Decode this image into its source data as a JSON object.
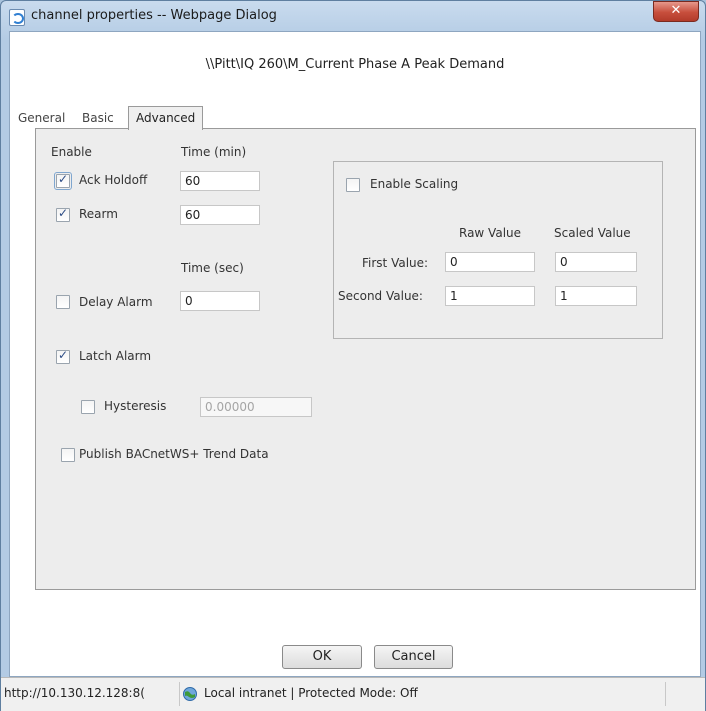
{
  "window": {
    "title": "channel properties -- Webpage Dialog",
    "close_label": "✕"
  },
  "header": {
    "path": "\\\\Pitt\\IQ 260\\M_Current Phase A Peak Demand"
  },
  "tabs": [
    {
      "label": "General",
      "active": false
    },
    {
      "label": "Basic",
      "active": false
    },
    {
      "label": "Advanced",
      "active": true
    }
  ],
  "advanced": {
    "enable_header": "Enable",
    "time_min_header": "Time (min)",
    "time_sec_header": "Time (sec)",
    "ack_holdoff": {
      "label": "Ack Holdoff",
      "checked": true,
      "value": "60"
    },
    "rearm": {
      "label": "Rearm",
      "checked": true,
      "value": "60"
    },
    "delay_alarm": {
      "label": "Delay Alarm",
      "checked": false,
      "value": "0"
    },
    "latch_alarm": {
      "label": "Latch Alarm",
      "checked": true
    },
    "hysteresis": {
      "label": "Hysteresis",
      "checked": false,
      "value": "0.00000"
    },
    "publish": {
      "label": "Publish BACnetWS+ Trend Data",
      "checked": false
    }
  },
  "scaling": {
    "enable_label": "Enable Scaling",
    "enabled": false,
    "raw_header": "Raw Value",
    "scaled_header": "Scaled Value",
    "first_label": "First Value:",
    "second_label": "Second Value:",
    "first_raw": "0",
    "first_scaled": "0",
    "second_raw": "1",
    "second_scaled": "1"
  },
  "buttons": {
    "ok": "OK",
    "cancel": "Cancel"
  },
  "statusbar": {
    "url": "http://10.130.12.128:8(",
    "zone": "Local intranet | Protected Mode: Off"
  },
  "colors": {
    "titlebar": "#c9dbee",
    "close": "#c74e3c",
    "panel": "#ededed",
    "accent": "#2c4c86"
  },
  "icons": {
    "app": "ie-page-icon",
    "zone": "globe-icon",
    "close": "close-icon"
  }
}
